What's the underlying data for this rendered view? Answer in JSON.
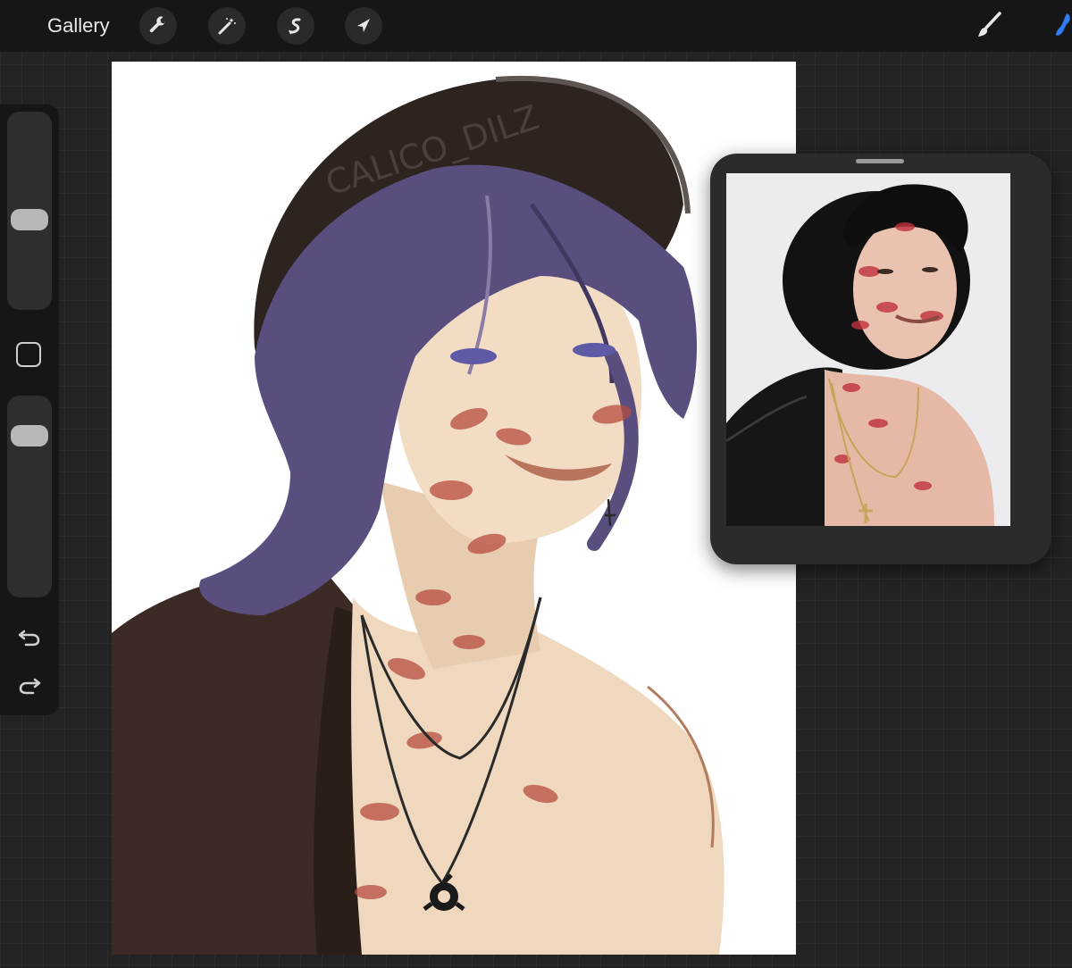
{
  "toolbar": {
    "gallery_label": "Gallery",
    "tools": [
      {
        "name": "wrench-icon",
        "label": "Actions"
      },
      {
        "name": "magic-wand-icon",
        "label": "Adjustments"
      },
      {
        "name": "selection-s-icon",
        "label": "Selection"
      },
      {
        "name": "arrow-cursor-icon",
        "label": "Transform"
      }
    ],
    "right_tools": [
      {
        "name": "brush-icon",
        "label": "Paint"
      },
      {
        "name": "smudge-icon",
        "label": "Smudge"
      }
    ]
  },
  "sidebar": {
    "brush_size_level": 0.45,
    "opacity_level": 0.85
  },
  "canvas": {
    "artwork_signature": "CALICO_DILZ"
  },
  "colors": {
    "toolbar_bg": "#161617",
    "accent_blue": "#2f7bf6",
    "hair_purple": "#5a4e7e",
    "hat_dark": "#2d2420",
    "kiss_red": "#b84c3f"
  }
}
